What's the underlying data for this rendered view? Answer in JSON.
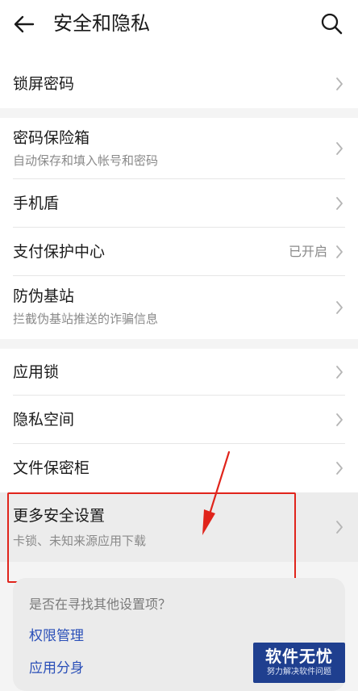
{
  "header": {
    "title": "安全和隐私",
    "back_icon": "arrow-left-icon",
    "search_icon": "search-icon"
  },
  "groups": [
    {
      "items": [
        {
          "label": "锁屏密码"
        }
      ]
    },
    {
      "items": [
        {
          "label": "密码保险箱",
          "sublabel": "自动保存和填入帐号和密码"
        },
        {
          "label": "手机盾"
        },
        {
          "label": "支付保护中心",
          "value": "已开启"
        },
        {
          "label": "防伪基站",
          "sublabel": "拦截伪基站推送的诈骗信息"
        }
      ]
    },
    {
      "items": [
        {
          "label": "应用锁"
        },
        {
          "label": "隐私空间"
        },
        {
          "label": "文件保密柜"
        },
        {
          "label": "更多安全设置",
          "sublabel": "卡锁、未知来源应用下载"
        }
      ]
    }
  ],
  "suggestions": {
    "question": "是否在寻找其他设置项？",
    "links": [
      "权限管理",
      "应用分身"
    ]
  },
  "watermark": {
    "title": "软件无忧",
    "subtitle": "努力解决软件问题"
  },
  "colors": {
    "annotation_red": "#e0241b",
    "link_blue": "#2a4fb8",
    "watermark_bg": "#1f3f8f"
  }
}
